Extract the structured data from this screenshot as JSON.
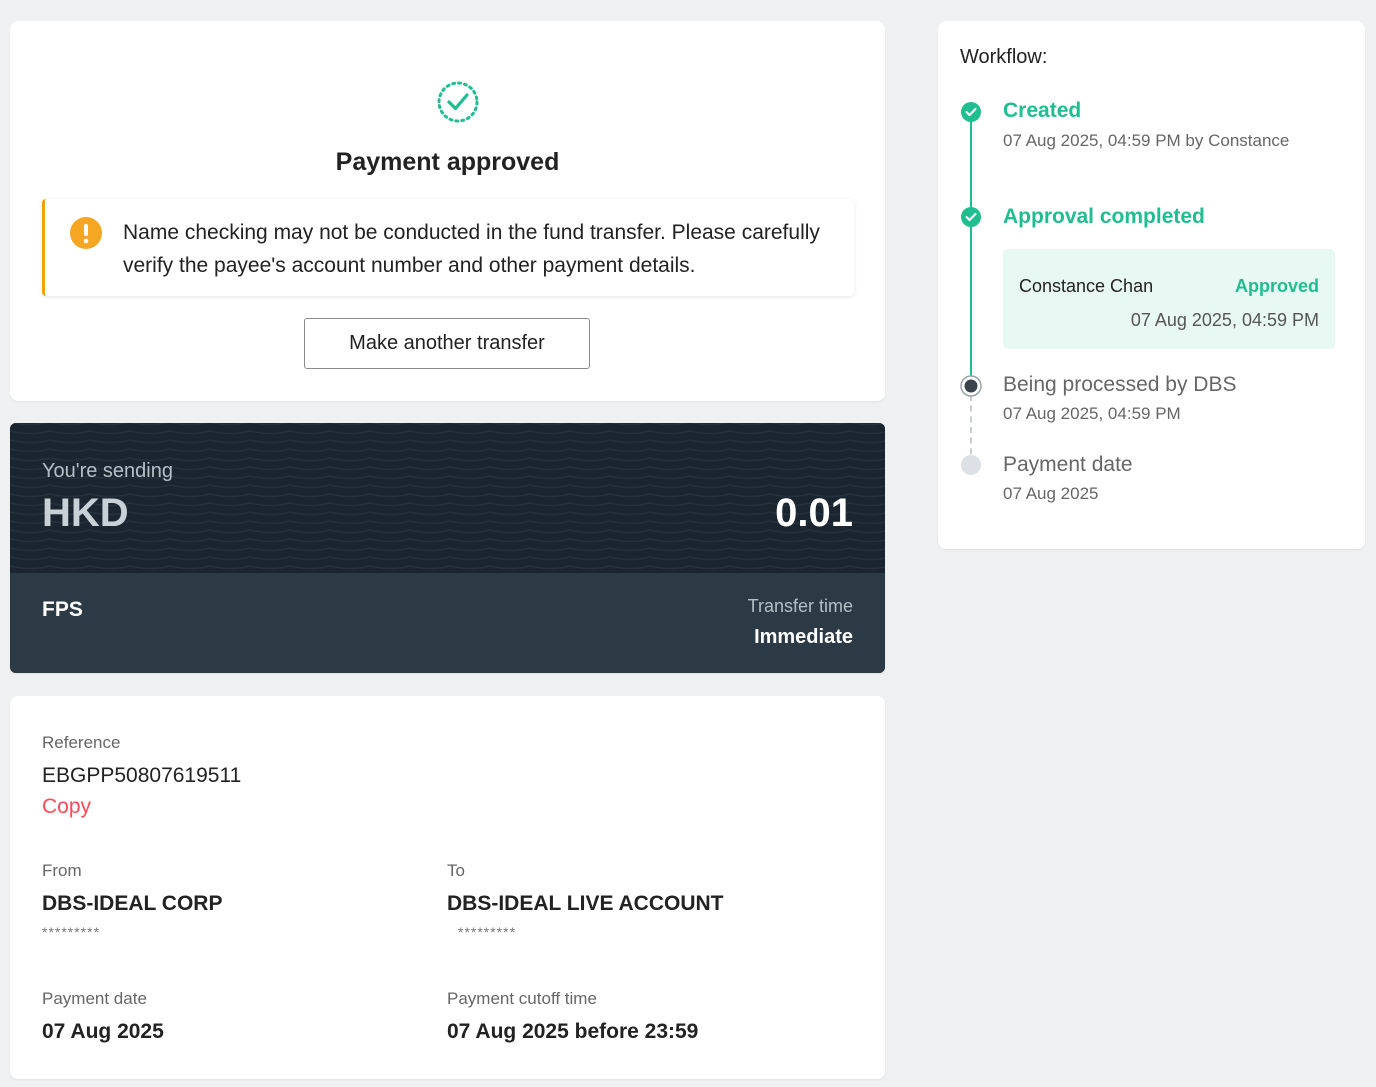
{
  "status": {
    "title": "Payment approved",
    "icon": "check-badge-icon",
    "warning_icon": "exclamation-circle-icon",
    "warning_text": "Name checking may not be conducted in the fund transfer. Please carefully verify the payee's account number and other payment details.",
    "button_label": "Make another transfer"
  },
  "amount": {
    "sending_label": "You're sending",
    "currency": "HKD",
    "value": "0.01",
    "method": "FPS",
    "transfer_time_label": "Transfer time",
    "transfer_time_value": "Immediate"
  },
  "details": {
    "reference_label": "Reference",
    "reference_value": "EBGPP50807619511",
    "copy_label": "Copy",
    "from_label": "From",
    "from_value": "DBS-IDEAL CORP",
    "from_account": "*********",
    "to_label": "To",
    "to_value": "DBS-IDEAL LIVE ACCOUNT",
    "to_account": "*********",
    "payment_date_label": "Payment date",
    "payment_date_value": "07 Aug 2025",
    "cutoff_label": "Payment cutoff time",
    "cutoff_value": "07 Aug 2025 before 23:59"
  },
  "workflow": {
    "title": "Workflow:",
    "steps": [
      {
        "title": "Created",
        "subtitle": "07 Aug 2025, 04:59 PM by Constance",
        "state": "done"
      },
      {
        "title": "Approval completed",
        "subtitle": "",
        "state": "done"
      },
      {
        "title": "Being processed by DBS",
        "subtitle": "07 Aug 2025, 04:59 PM",
        "state": "current"
      },
      {
        "title": "Payment date",
        "subtitle": "07 Aug 2025",
        "state": "pending"
      }
    ],
    "approver": {
      "name": "Constance Chan",
      "status": "Approved",
      "time": "07 Aug 2025, 04:59 PM"
    }
  },
  "colors": {
    "success": "#1fbe8f",
    "warning": "#f0a20a",
    "link": "#ff4b55",
    "dark_panel": "#1a2530"
  }
}
